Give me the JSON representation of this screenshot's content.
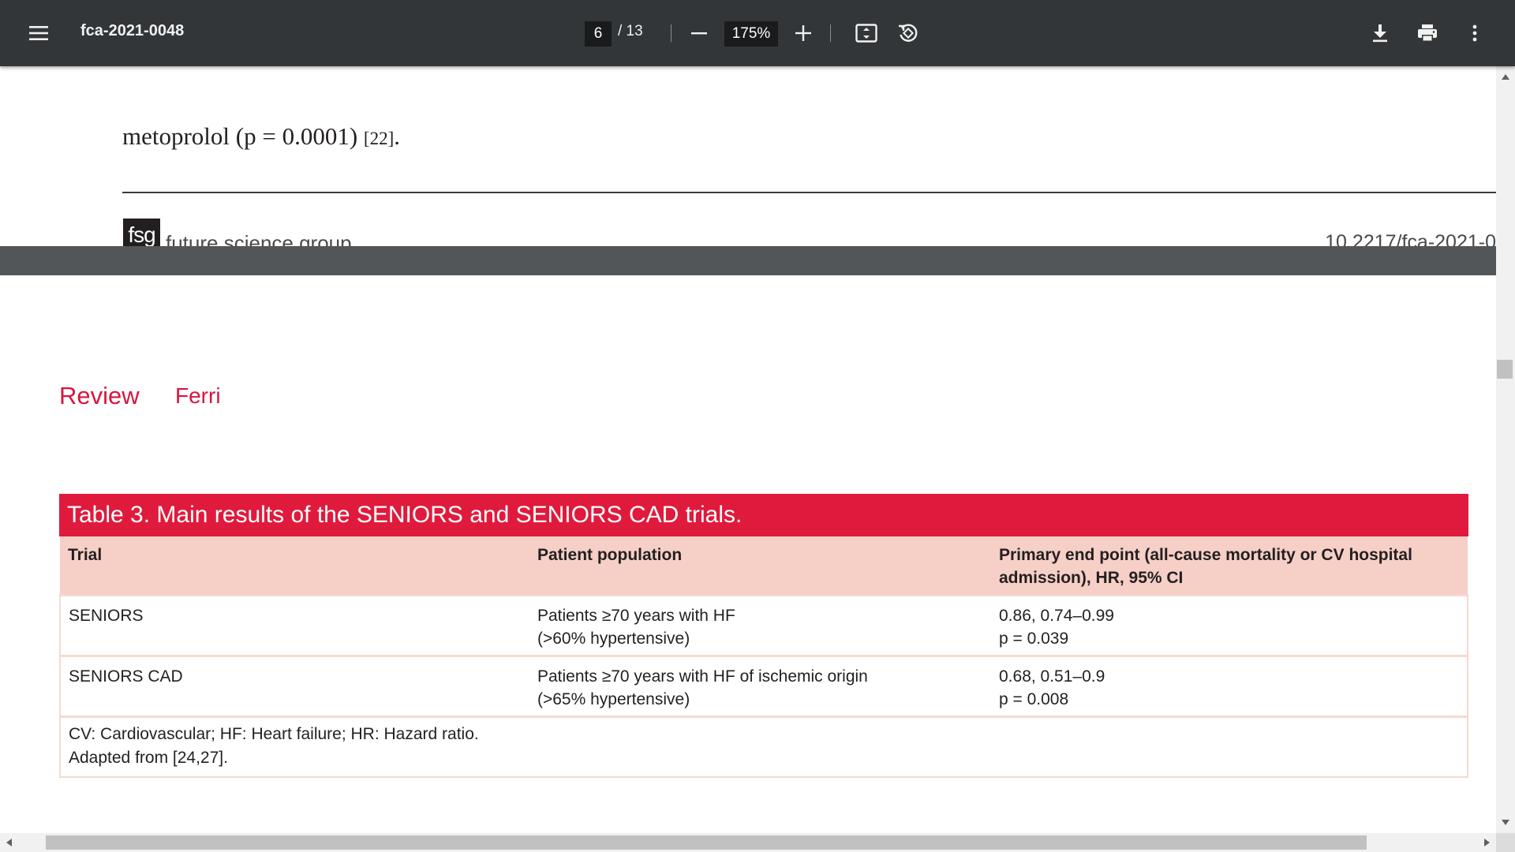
{
  "toolbar": {
    "menu_icon": "hamburger-menu-icon",
    "title": "fca-2021-0048",
    "page_current": "6",
    "page_total": "/ 13",
    "zoom_out_icon": "minus-icon",
    "zoom": "175%",
    "zoom_in_icon": "plus-icon",
    "fit_icon": "fit-to-page-icon",
    "rotate_icon": "rotate-counterclockwise-icon",
    "download_icon": "download-icon",
    "print_icon": "printer-icon",
    "more_icon": "vertical-ellipsis-icon"
  },
  "page_top": {
    "text_main": "metoprolol (p = 0.0001) ",
    "text_ref": "[22]",
    "text_end": ".",
    "logo_text": "fsg",
    "publisher": "future science group",
    "doi": "10.2217/fca-2021-0"
  },
  "page_bottom": {
    "section_label": "Review",
    "author": "Ferri",
    "table": {
      "caption": "Table 3.  Main results of the SENIORS and SENIORS CAD trials.",
      "headers": [
        "Trial",
        "Patient population",
        "Primary end point (all-cause mortality or CV hospital admission), HR, 95% CI"
      ],
      "rows": [
        {
          "trial": "SENIORS",
          "population": [
            "Patients ≥70 years with HF",
            "(>60% hypertensive)"
          ],
          "endpoint": [
            "0.86, 0.74–0.99",
            "p = 0.039"
          ]
        },
        {
          "trial": "SENIORS CAD",
          "population": [
            "Patients ≥70 years with HF of ischemic origin",
            "(>65% hypertensive)"
          ],
          "endpoint": [
            "0.68, 0.51–0.9",
            "p = 0.008"
          ]
        }
      ],
      "footnote": [
        "CV: Cardiovascular; HF: Heart failure; HR: Hazard ratio.",
        "Adapted from [24,27]."
      ]
    }
  },
  "colors": {
    "toolbar_bg": "#323639",
    "accent_red": "#e01a3c",
    "header_pink": "#f6cfc7",
    "viewer_bg": "#525659"
  }
}
